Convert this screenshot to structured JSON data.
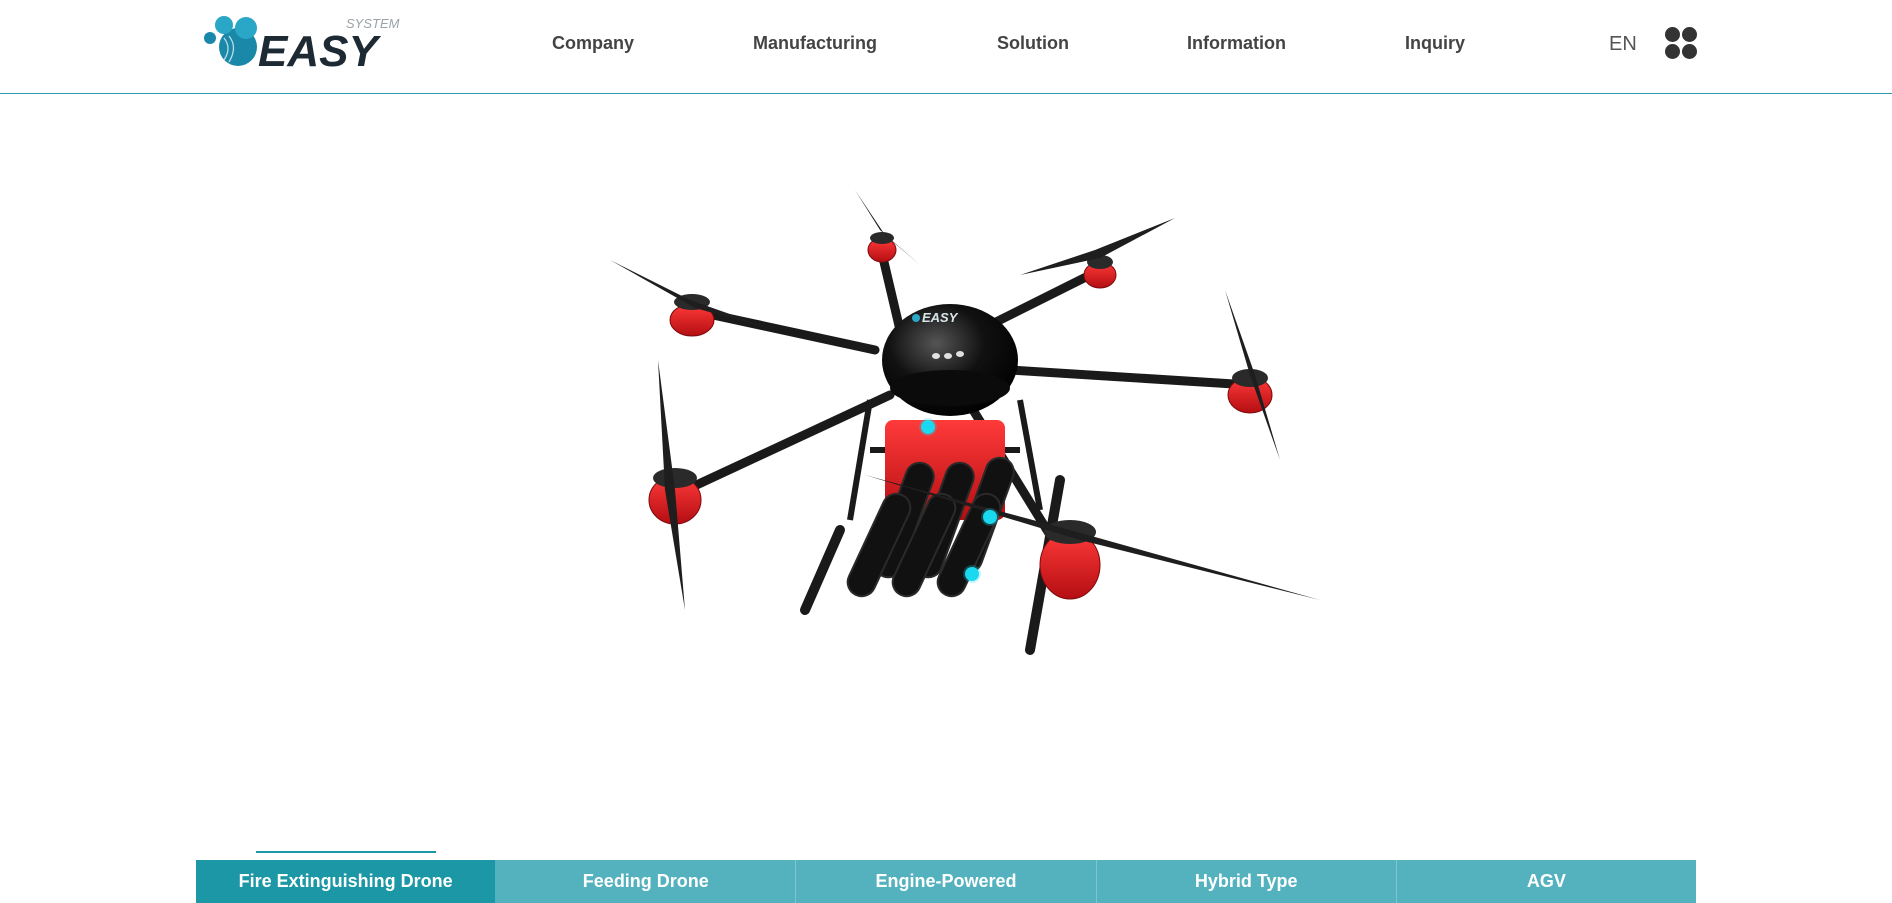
{
  "header": {
    "logo_text": "EASY",
    "logo_subtext": "SYSTEM",
    "nav": [
      {
        "label": "Company"
      },
      {
        "label": "Manufacturing"
      },
      {
        "label": "Solution"
      },
      {
        "label": "Information"
      },
      {
        "label": "Inquiry"
      }
    ],
    "language": "EN",
    "menu_icon": "grid-dots-icon"
  },
  "main": {
    "product_image": "hexacopter-fire-extinguishing-drone",
    "body_logo_text": "EASY",
    "hotspot_icon": "hotspot-dot-icon"
  },
  "tabs": [
    {
      "label": "Fire Extinguishing Drone",
      "active": true
    },
    {
      "label": "Feeding Drone",
      "active": false
    },
    {
      "label": "Engine-Powered",
      "active": false
    },
    {
      "label": "Hybrid Type",
      "active": false
    },
    {
      "label": "AGV",
      "active": false
    }
  ],
  "colors": {
    "accent": "#1c97a5",
    "tab_bg": "#54b2bf",
    "hotspot": "#1ad8f0",
    "nav_text": "#444444",
    "drone_red": "#d4141b"
  }
}
